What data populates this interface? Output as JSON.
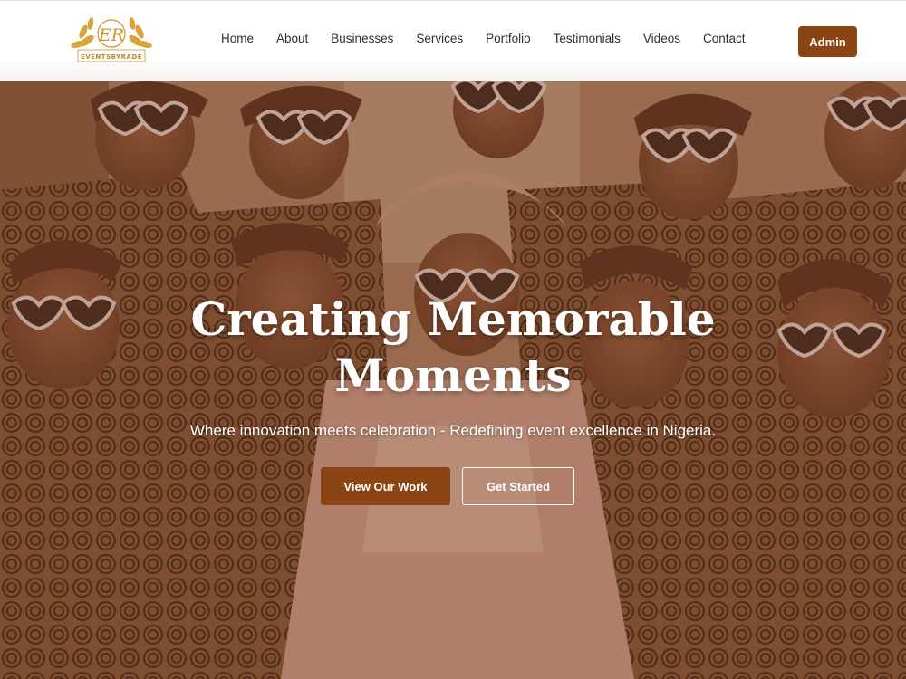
{
  "logo": {
    "monogram": "ER",
    "wordmark": "EVENTSBYRADE"
  },
  "nav": {
    "links": [
      "Home",
      "About",
      "Businesses",
      "Services",
      "Portfolio",
      "Testimonials",
      "Videos",
      "Contact"
    ],
    "admin_label": "Admin"
  },
  "hero": {
    "title_line1": "Creating Memorable",
    "title_line2": "Moments",
    "subtitle": "Where innovation meets celebration - Redefining event excellence in Nigeria.",
    "primary_cta": "View Our Work",
    "secondary_cta": "Get Started"
  },
  "colors": {
    "brand_brown": "#8b4513",
    "logo_gold": "#c9952e"
  }
}
